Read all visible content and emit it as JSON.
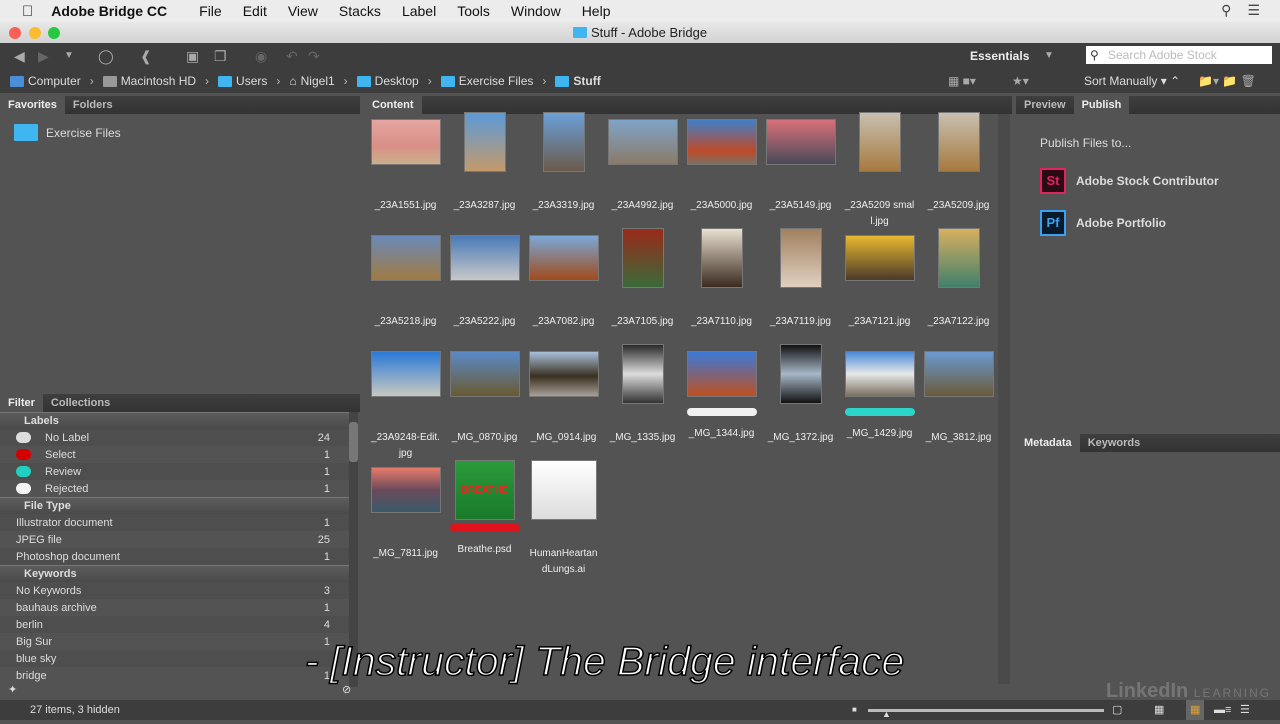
{
  "menubar": {
    "app": "Adobe Bridge CC",
    "items": [
      "File",
      "Edit",
      "View",
      "Stacks",
      "Label",
      "Tools",
      "Window",
      "Help"
    ]
  },
  "window": {
    "title": "Stuff - Adobe Bridge"
  },
  "toolbar": {
    "workspace": "Essentials",
    "search_placeholder": "Search Adobe Stock",
    "sort": "Sort Manually"
  },
  "path": [
    "Computer",
    "Macintosh HD",
    "Users",
    "Nigel1",
    "Desktop",
    "Exercise Files",
    "Stuff"
  ],
  "favorites": {
    "tabs": [
      "Favorites",
      "Folders"
    ],
    "items": [
      "Exercise Files"
    ]
  },
  "content": {
    "tab": "Content",
    "items": [
      {
        "name": "_23A1551.jpg"
      },
      {
        "name": "_23A3287.jpg"
      },
      {
        "name": "_23A3319.jpg"
      },
      {
        "name": "_23A4992.jpg"
      },
      {
        "name": "_23A5000.jpg"
      },
      {
        "name": "_23A5149.jpg"
      },
      {
        "name": "_23A5209 small.jpg"
      },
      {
        "name": "_23A5209.jpg"
      },
      {
        "name": "_23A5218.jpg"
      },
      {
        "name": "_23A5222.jpg"
      },
      {
        "name": "_23A7082.jpg"
      },
      {
        "name": "_23A7105.jpg"
      },
      {
        "name": "_23A7110.jpg"
      },
      {
        "name": "_23A7119.jpg"
      },
      {
        "name": "_23A7121.jpg"
      },
      {
        "name": "_23A7122.jpg"
      },
      {
        "name": "_23A9248-Edit.jpg"
      },
      {
        "name": "_MG_0870.jpg"
      },
      {
        "name": "_MG_0914.jpg"
      },
      {
        "name": "_MG_1335.jpg"
      },
      {
        "name": "_MG_1344.jpg",
        "label": "#f0f0f0"
      },
      {
        "name": "_MG_1372.jpg"
      },
      {
        "name": "_MG_1429.jpg",
        "label": "#2dd4c8"
      },
      {
        "name": "_MG_3812.jpg"
      },
      {
        "name": "_MG_7811.jpg"
      },
      {
        "name": "Breathe.psd",
        "label": "#e0121b",
        "thumb_text": "BREATHE"
      },
      {
        "name": "HumanHeartandLungs.ai"
      }
    ]
  },
  "publish": {
    "tabs": [
      "Preview",
      "Publish"
    ],
    "heading": "Publish Files to...",
    "targets": [
      {
        "icon": "St",
        "label": "Adobe Stock Contributor",
        "color": "#e0245e"
      },
      {
        "icon": "Pf",
        "label": "Adobe Portfolio",
        "color": "#3aa0f0"
      }
    ]
  },
  "metadata": {
    "tabs": [
      "Metadata",
      "Keywords"
    ]
  },
  "filter": {
    "tabs": [
      "Filter",
      "Collections"
    ],
    "labels": {
      "title": "Labels",
      "rows": [
        {
          "name": "No Label",
          "count": "24",
          "color": "#dddddd"
        },
        {
          "name": "Select",
          "count": "1",
          "color": "#d40000"
        },
        {
          "name": "Review",
          "count": "1",
          "color": "#1fd0c0"
        },
        {
          "name": "Rejected",
          "count": "1",
          "color": "#f4f4f4"
        }
      ]
    },
    "filetype": {
      "title": "File Type",
      "rows": [
        {
          "name": "Illustrator document",
          "count": "1"
        },
        {
          "name": "JPEG file",
          "count": "25"
        },
        {
          "name": "Photoshop document",
          "count": "1"
        }
      ]
    },
    "keywords": {
      "title": "Keywords",
      "rows": [
        {
          "name": "No Keywords",
          "count": "3"
        },
        {
          "name": "bauhaus archive",
          "count": "1"
        },
        {
          "name": "berlin",
          "count": "4"
        },
        {
          "name": "Big Sur",
          "count": "1"
        },
        {
          "name": "blue sky",
          "count": ""
        },
        {
          "name": "bridge",
          "count": "1"
        }
      ]
    }
  },
  "status": {
    "text": "27 items, 3 hidden"
  },
  "caption": "- [Instructor] The Bridge interface",
  "watermark": "LinkedIn LEARNING"
}
